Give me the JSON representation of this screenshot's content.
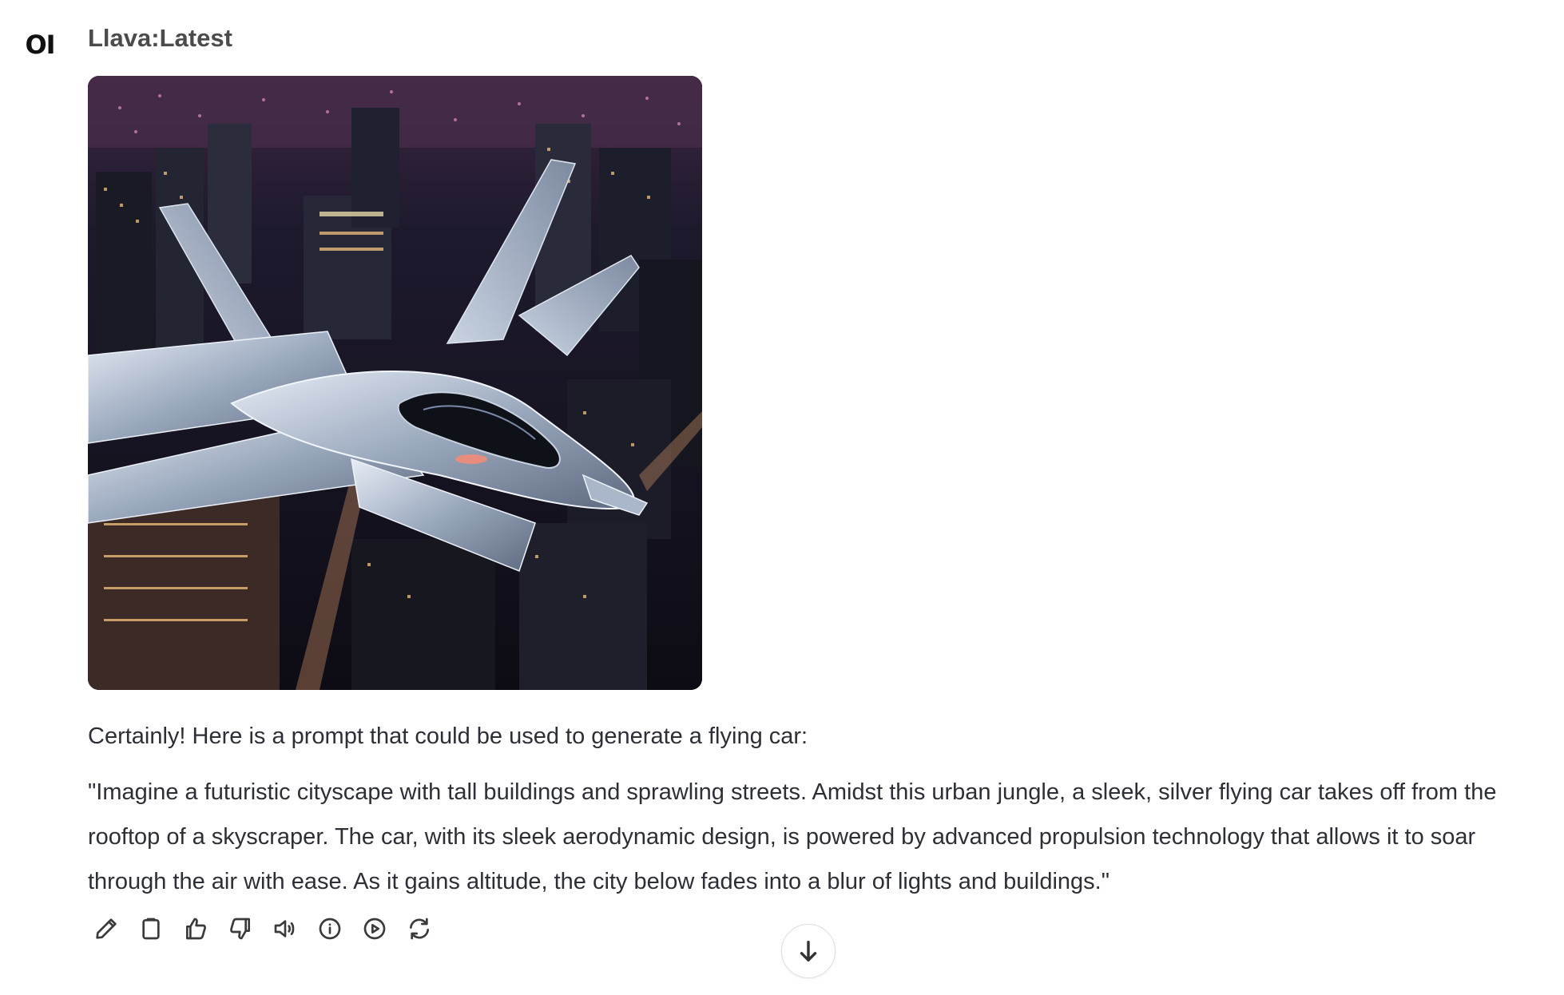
{
  "assistant": {
    "avatar_text": "OI",
    "model_name": "Llava:Latest"
  },
  "image": {
    "subject": "silver flying car jet over night city skyscrapers"
  },
  "message": {
    "intro": "Certainly! Here is a prompt that could be used to generate a flying car:",
    "quote": "\"Imagine a futuristic cityscape with tall buildings and sprawling streets. Amidst this urban jungle, a sleek, silver flying car takes off from the rooftop of a skyscraper. The car, with its sleek aerodynamic design, is powered by advanced propulsion technology that allows it to soar through the air with ease. As it gains altitude, the city below fades into a blur of lights and buildings.\""
  },
  "actions": [
    {
      "name": "edit-icon"
    },
    {
      "name": "copy-icon"
    },
    {
      "name": "thumbs-up-icon"
    },
    {
      "name": "thumbs-down-icon"
    },
    {
      "name": "speaker-icon"
    },
    {
      "name": "info-icon"
    },
    {
      "name": "play-icon"
    },
    {
      "name": "regenerate-icon"
    }
  ],
  "scroll_button": {
    "icon": "arrow-down-icon"
  },
  "colors": {
    "text": "#2d2f36",
    "model_name": "#4b4b4b",
    "background": "#ffffff"
  }
}
